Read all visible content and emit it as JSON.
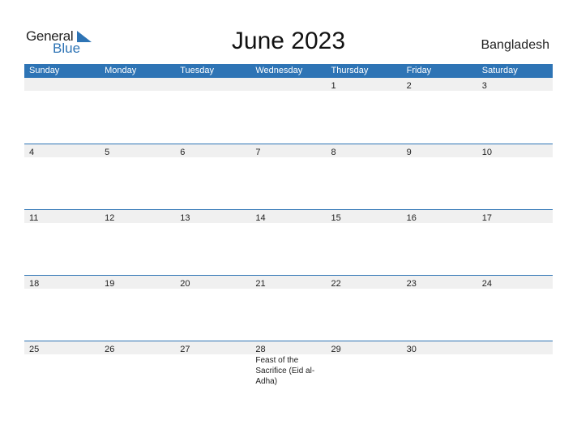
{
  "logo": {
    "general": "General",
    "blue": "Blue"
  },
  "title": "June 2023",
  "country": "Bangladesh",
  "colors": {
    "accent": "#2e74b5",
    "band": "#f0f0f0"
  },
  "days": [
    "Sunday",
    "Monday",
    "Tuesday",
    "Wednesday",
    "Thursday",
    "Friday",
    "Saturday"
  ],
  "weeks": [
    [
      "",
      "",
      "",
      "",
      "1",
      "2",
      "3"
    ],
    [
      "4",
      "5",
      "6",
      "7",
      "8",
      "9",
      "10"
    ],
    [
      "11",
      "12",
      "13",
      "14",
      "15",
      "16",
      "17"
    ],
    [
      "18",
      "19",
      "20",
      "21",
      "22",
      "23",
      "24"
    ],
    [
      "25",
      "26",
      "27",
      "28",
      "29",
      "30",
      ""
    ]
  ],
  "events": [
    {
      "week": 4,
      "day": 3,
      "text": "Feast of the Sacrifice (Eid al-Adha)"
    }
  ]
}
